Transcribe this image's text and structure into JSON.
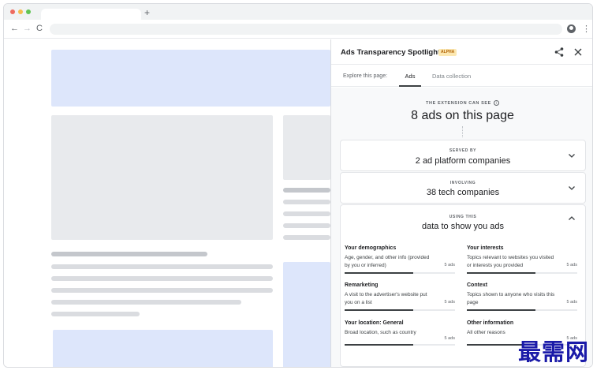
{
  "browser": {
    "new_tab_symbol": "+",
    "back_symbol": "←",
    "forward_symbol": "→",
    "reload_symbol": "C",
    "menu_symbol": "⋮"
  },
  "panel": {
    "title": "Ads Transparency Spotlight",
    "badge": "ALPHA",
    "tabs_label": "Explore this page:",
    "tabs": [
      {
        "label": "Ads",
        "active": true
      },
      {
        "label": "Data collection",
        "active": false
      }
    ],
    "can_see_label": "THE EXTENSION CAN SEE",
    "info_symbol": "i",
    "ads_count": "8 ads on this page",
    "cards": [
      {
        "small": "SERVED BY",
        "main": "2 ad platform companies",
        "expanded": false
      },
      {
        "small": "INVOLVING",
        "main": "38 tech companies",
        "expanded": false
      },
      {
        "small": "USING THIS",
        "main": "data to show you ads",
        "expanded": true
      }
    ],
    "categories": [
      {
        "title": "Your demographics",
        "desc": "Age, gender, and other info (provided by you or inferred)",
        "count": "5 ads",
        "fill": 0.62
      },
      {
        "title": "Your interests",
        "desc": "Topics relevant to websites you visited or interests you provided",
        "count": "5 ads",
        "fill": 0.62
      },
      {
        "title": "Remarketing",
        "desc": "A visit to the advertiser's website put you on a list",
        "count": "5 ads",
        "fill": 0.62
      },
      {
        "title": "Context",
        "desc": "Topics shown to anyone who visits this page",
        "count": "5 ads",
        "fill": 0.62
      },
      {
        "title": "Your location: General",
        "desc": "Broad location, such as country",
        "count": "5 ads",
        "fill": 0.62
      },
      {
        "title": "Other information",
        "desc": "All other reasons",
        "count": "5 ads",
        "fill": 0.62
      }
    ]
  },
  "colors": {
    "accent": "#3c4043",
    "badge_bg": "#fce8b2",
    "placeholder_blue": "#dde6fb",
    "placeholder_grey": "#e8eaed"
  },
  "watermark": "最需网"
}
